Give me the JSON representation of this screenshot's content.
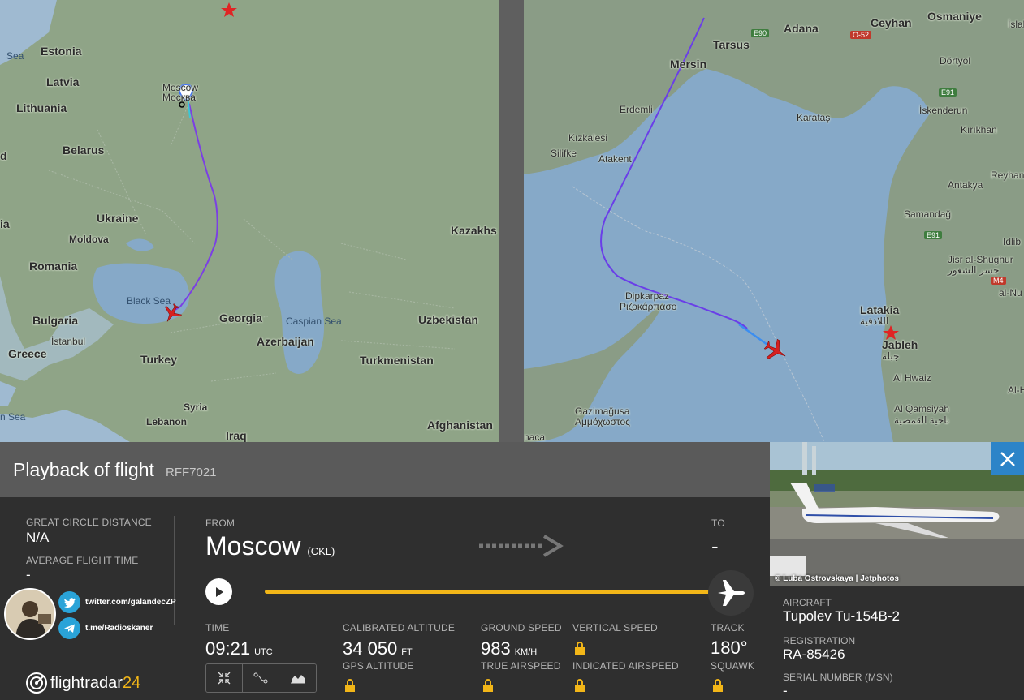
{
  "map_left": {
    "labels": {
      "estonia": "Estonia",
      "latvia": "Latvia",
      "lithuania": "Lithuania",
      "belarus": "Belarus",
      "ukraine": "Ukraine",
      "moldova": "Moldova",
      "romania": "Romania",
      "bulgaria": "Bulgaria",
      "greece": "Greece",
      "turkey": "Turkey",
      "georgia": "Georgia",
      "azerbaijan": "Azerbaijan",
      "uzbekistan": "Uzbekistan",
      "turkmenistan": "Turkmenistan",
      "kazakhs": "Kazakhs",
      "syria": "Syria",
      "lebanon": "Lebanon",
      "iraq": "Iraq",
      "afghanistan": "Afghanistan",
      "istanbul": "İstanbul",
      "moscow": "Moscow",
      "moskva": "Москва",
      "black_sea": "Black Sea",
      "caspian_sea": "Caspian Sea",
      "sea_top": "Sea",
      "sea_bottom": "n Sea",
      "edge_d": "d",
      "edge_ia": "ia"
    }
  },
  "map_right": {
    "labels": {
      "adana": "Adana",
      "osmaniye": "Osmaniye",
      "ceyhan": "Ceyhan",
      "tarsus": "Tarsus",
      "mersin": "Mersin",
      "dortyol": "Dörtyol",
      "erdemli": "Erdemli",
      "iskenderun": "İskenderun",
      "karatas": "Karataş",
      "kirikhan": "Kırıkhan",
      "kizkalesi": "Kızkalesi",
      "silifke": "Silifke",
      "atakent": "Atakent",
      "reyhanli": "Reyhanlı",
      "antakya": "Antakya",
      "samandag": "Samandağ",
      "idlib": "Idlib",
      "jisr": "Jisr al-Shughur",
      "jisr_ar": "جسر الشغور",
      "alnu": "al-Nu",
      "dipkarpaz": "Dipkarpaz",
      "rizokarpaso": "Ριζοκάρπασο",
      "latakia": "Latakia",
      "latakia_ar": "اللاذقية",
      "jableh": "Jableh",
      "jableh_ar": "جبلة",
      "alhwaiz": "Al Hwaiz",
      "alqamsiyah": "Al Qamsiyah",
      "alqamsiyah_ar": "ناحية القمصية",
      "gazimagusa": "Gazimağusa",
      "ammochostos": "Αμμόχωστος",
      "naca": "naca",
      "islah": "İslah",
      "alhaf": "Al-Haf",
      "e90": "E90",
      "o52": "O-52",
      "e91_a": "E91",
      "e91_b": "E91",
      "m4": "M4"
    }
  },
  "panel": {
    "title": "Playback of flight",
    "callsign": "RFF7021",
    "great_circle_label": "GREAT CIRCLE DISTANCE",
    "great_circle_value": "N/A",
    "avg_flight_label": "AVERAGE FLIGHT TIME",
    "avg_flight_value": "-",
    "from_label": "FROM",
    "from_city": "Moscow",
    "from_code": "(CKL)",
    "to_label": "TO",
    "to_value": "-",
    "time_label": "TIME",
    "time_value": "09:21",
    "time_unit": "UTC",
    "cal_alt_label": "CALIBRATED ALTITUDE",
    "cal_alt_value": "34 050",
    "cal_alt_unit": "FT",
    "gps_alt_label": "GPS ALTITUDE",
    "ground_speed_label": "GROUND SPEED",
    "ground_speed_value": "983",
    "ground_speed_unit": "KM/H",
    "true_airspeed_label": "TRUE AIRSPEED",
    "vertical_speed_label": "VERTICAL SPEED",
    "indicated_airspeed_label": "INDICATED AIRSPEED",
    "track_label": "TRACK",
    "track_value": "180°",
    "squawk_label": "SQUAWK",
    "playback_progress": 1.0
  },
  "social": {
    "twitter": "twitter.com/galandecZP",
    "telegram": "t.me/Radioskaner"
  },
  "brand": {
    "name": "flightradar",
    "num": "24"
  },
  "side": {
    "photo_credit": "© Luba Ostrovskaya | Jetphotos",
    "aircraft_label": "AIRCRAFT",
    "aircraft_value": "Tupolev Tu-154B-2",
    "registration_label": "REGISTRATION",
    "registration_value": "RA-85426",
    "serial_label": "SERIAL NUMBER (MSN)",
    "serial_value": "-"
  },
  "colors": {
    "accent": "#f2b618",
    "close": "#2c84c8",
    "track_purple": "#7b3fe4",
    "track_blue": "#3b6ff0",
    "plane_red": "#d62020"
  }
}
